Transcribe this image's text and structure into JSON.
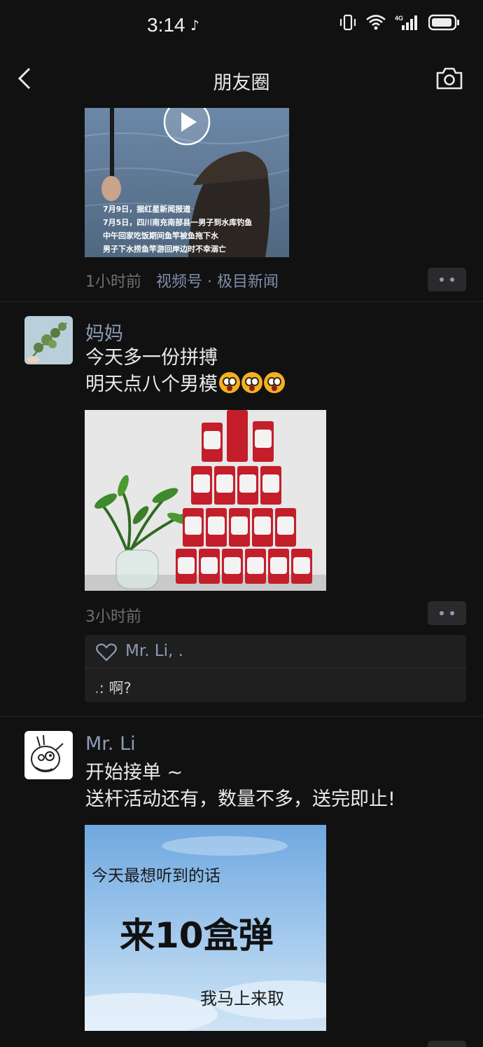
{
  "status": {
    "time": "3:14",
    "network": "4G"
  },
  "nav": {
    "title": "朋友圈"
  },
  "posts": [
    {
      "video_caption": [
        "7月9日，据红星新闻报道",
        "7月5日，四川南充南部县一男子到水库钓鱼",
        "中午回家吃饭期间鱼竿被鱼拖下水",
        "男子下水捞鱼竿游回岸边时不幸溺亡"
      ],
      "time": "1小时前",
      "source": "视频号 · 极目新闻"
    },
    {
      "name": "妈妈",
      "lines": [
        "今天多一份拼搏",
        "明天点八个男模"
      ],
      "time": "3小时前",
      "likes": "Mr. Li, .",
      "comment": {
        "name": ".",
        "text": ": 啊?"
      }
    },
    {
      "name": "Mr. Li",
      "lines": [
        "开始接单 ~",
        "送杆活动还有，数量不多，送完即止!"
      ],
      "image_lines": [
        "今天最想听到的话",
        "来10盒弹",
        "我马上来取"
      ]
    }
  ],
  "colors": {
    "background": "#111111",
    "name_link": "#8c9bb8",
    "meta": "#6f6f6f"
  }
}
